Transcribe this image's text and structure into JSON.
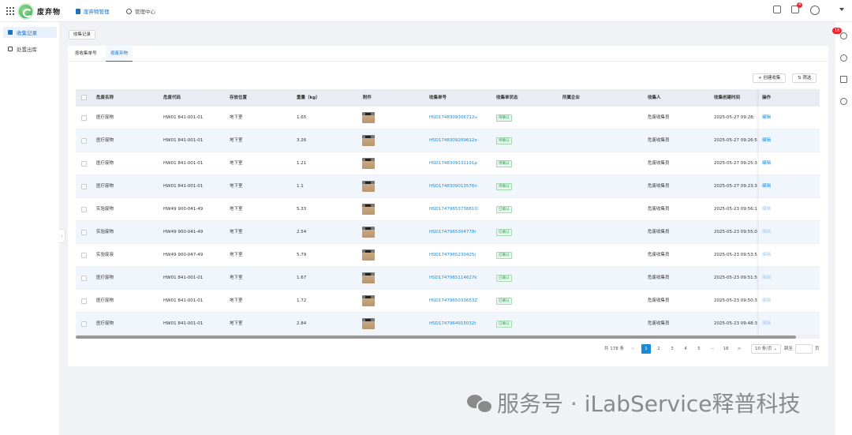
{
  "brand": "废弃物",
  "nav": [
    {
      "label": "废弃物管理",
      "icon": "document-icon",
      "active": true
    },
    {
      "label": "管理中心",
      "icon": "gear-icon",
      "active": false
    }
  ],
  "topbar": {
    "notification_badge": "4"
  },
  "sidebar": {
    "items": [
      {
        "label": "收集记录",
        "icon": "record-icon",
        "active": true
      },
      {
        "label": "处置出库",
        "icon": "outbound-icon",
        "active": false
      }
    ]
  },
  "rail": {
    "badge": "16"
  },
  "page_tag": "收集记录",
  "tabs": [
    {
      "label": "按收集单号",
      "active": false
    },
    {
      "label": "按废弃物",
      "active": true
    }
  ],
  "toolbar": {
    "create_label": "+ 创建收集",
    "filter_label": "筛选"
  },
  "table": {
    "columns": [
      "危废名称",
      "危废代码",
      "存放位置",
      "重量（kg）",
      "附件",
      "收集单号",
      "收集单状态",
      "所属企业",
      "收集人",
      "收集创建时间",
      "操作"
    ],
    "rows": [
      {
        "name": "医疗废物",
        "code": "HW01 841-001-01",
        "location": "地下室",
        "weight": "1.65",
        "order": "HSD1748309306712u",
        "status": "待确认",
        "status_type": "pending",
        "company": "",
        "collector": "危废收集员",
        "time": "2025-05-27 09:28:",
        "action": "编辑",
        "action_enabled": true
      },
      {
        "name": "医疗废物",
        "code": "HW01 841-001-01",
        "location": "地下室",
        "weight": "3.26",
        "order": "HSD1748309209612o",
        "status": "待确认",
        "status_type": "pending",
        "company": "",
        "collector": "危废收集员",
        "time": "2025-05-27 09:26:5",
        "action": "编辑",
        "action_enabled": true
      },
      {
        "name": "医疗废物",
        "code": "HW01 841-001-01",
        "location": "地下室",
        "weight": "1.21",
        "order": "HSD1748309131191p",
        "status": "待确认",
        "status_type": "pending",
        "company": "",
        "collector": "危废收集员",
        "time": "2025-05-27 09:25:3",
        "action": "编辑",
        "action_enabled": true
      },
      {
        "name": "医疗废物",
        "code": "HW01 841-001-01",
        "location": "地下室",
        "weight": "1.1",
        "order": "HSD1748309013576n",
        "status": "待确认",
        "status_type": "pending",
        "company": "",
        "collector": "危废收集员",
        "time": "2025-05-27 09:23:3",
        "action": "编辑",
        "action_enabled": true
      },
      {
        "name": "实验废物",
        "code": "HW49 900-041-49",
        "location": "地下室",
        "weight": "5.33",
        "order": "HSD1747965373881O",
        "status": "已确认",
        "status_type": "done",
        "company": "",
        "collector": "危废收集员",
        "time": "2025-05-23 09:56:1",
        "action": "编辑",
        "action_enabled": false
      },
      {
        "name": "实验废物",
        "code": "HW49 900-041-49",
        "location": "地下室",
        "weight": "2.54",
        "order": "HSD1747965304778r",
        "status": "已确认",
        "status_type": "done",
        "company": "",
        "collector": "危废收集员",
        "time": "2025-05-23 09:55:0",
        "action": "编辑",
        "action_enabled": false
      },
      {
        "name": "实验废液",
        "code": "HW49 900-047-49",
        "location": "地下室",
        "weight": "5.79",
        "order": "HSD1747965230425j",
        "status": "已确认",
        "status_type": "done",
        "company": "",
        "collector": "危废收集员",
        "time": "2025-05-23 09:53:5",
        "action": "编辑",
        "action_enabled": false
      },
      {
        "name": "医疗废物",
        "code": "HW01 841-001-01",
        "location": "地下室",
        "weight": "1.67",
        "order": "HSD1747965114627k",
        "status": "已确认",
        "status_type": "done",
        "company": "",
        "collector": "危废收集员",
        "time": "2025-05-23 09:51:5",
        "action": "编辑",
        "action_enabled": false
      },
      {
        "name": "医疗废物",
        "code": "HW01 841-001-01",
        "location": "地下室",
        "weight": "1.72",
        "order": "HSD1747965033653Z",
        "status": "已确认",
        "status_type": "done",
        "company": "",
        "collector": "危废收集员",
        "time": "2025-05-23 09:50:3",
        "action": "编辑",
        "action_enabled": false
      },
      {
        "name": "医疗废物",
        "code": "HW01 841-001-01",
        "location": "地下室",
        "weight": "2.84",
        "order": "HSD1747964915032t",
        "status": "已确认",
        "status_type": "done",
        "company": "",
        "collector": "危废收集员",
        "time": "2025-05-23 09:48:3",
        "action": "编辑",
        "action_enabled": false
      }
    ]
  },
  "pagination": {
    "total": "共 178 条",
    "pages": [
      "1",
      "2",
      "3",
      "4",
      "5",
      "···",
      "18"
    ],
    "current": "1",
    "prev": "<",
    "next": ">",
    "page_size": "10 条/页",
    "goto": "跳至",
    "page_unit": "页"
  },
  "watermark": "服务号 · iLabService释普科技"
}
